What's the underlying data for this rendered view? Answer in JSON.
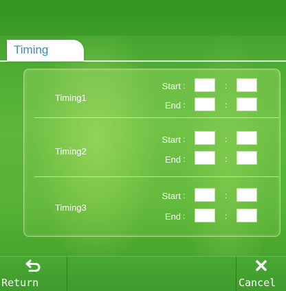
{
  "tab": {
    "label": "Timing"
  },
  "timings": [
    {
      "label": "Timing1",
      "start_label": "Start",
      "end_label": "End",
      "separator": ":",
      "start_hour": "",
      "start_minute": "",
      "end_hour": "",
      "end_minute": ""
    },
    {
      "label": "Timing2",
      "start_label": "Start",
      "end_label": "End",
      "separator": ":",
      "start_hour": "",
      "start_minute": "",
      "end_hour": "",
      "end_minute": ""
    },
    {
      "label": "Timing3",
      "start_label": "Start",
      "end_label": "End",
      "separator": ":",
      "start_hour": "",
      "start_minute": "",
      "end_hour": "",
      "end_minute": ""
    }
  ],
  "footer": {
    "return_label": "Return",
    "cancel_label": "Cancel",
    "return_icon": "return-arrow-icon",
    "cancel_icon": "close-icon"
  },
  "colors": {
    "background": "#4aa832",
    "tab_text": "#2f8fb8",
    "box_fill": "#ffffff"
  }
}
